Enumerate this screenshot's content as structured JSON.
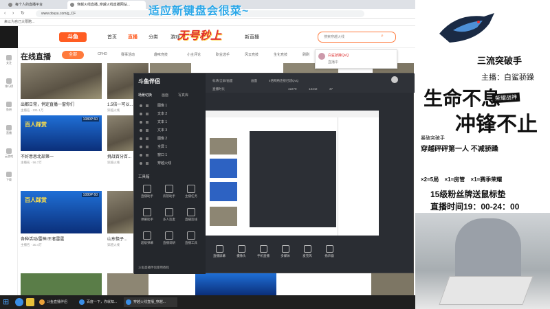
{
  "browser": {
    "tabs": [
      {
        "label": "每个人的直播平台"
      },
      {
        "label": "穿越火线直播_穿越火线直播网站..."
      }
    ],
    "url": "www.douyu.com/g_CF",
    "bookmark": "来以为自己大限赔..."
  },
  "douyu": {
    "logo": "斗鱼",
    "nav": [
      "首页",
      "直播",
      "分类",
      "游戏",
      "无号秒上",
      "新直播"
    ],
    "active_nav": "直播",
    "search_placeholder": "搜索穿越火线",
    "sidebar": [
      "关注",
      "排行榜",
      "鱼吧",
      "直播",
      "云游戏",
      "下载"
    ],
    "section_title": "在线直播",
    "all_button": "全部",
    "categories": [
      "CFHD",
      "赛事活动",
      "趣味竞技",
      "小主评论",
      "职业选手",
      "风云竞技",
      "生化竞技",
      "刷刷"
    ],
    "popup": {
      "line1": "白鲨骄躁QvQ",
      "line2": "直播中"
    },
    "cards": [
      {
        "title": "出都日常，悄定直播一窗你们",
        "meta": "主播名 · 221.1万"
      },
      {
        "title": "1.5倍一可以...",
        "meta": "穿越火线"
      },
      {
        "title": "不好意思北部第一",
        "meta": "主播名 · 56.7万"
      },
      {
        "title": "挑战百分百...",
        "meta": "穿越火线"
      },
      {
        "title": "各种活动/雷神/王者雷霆",
        "meta": "主播名 · 30.4万"
      },
      {
        "title": "山东筷子...",
        "meta": "穿越火线"
      }
    ],
    "card_promo": "百人踩赏",
    "card_res": "1080P 60"
  },
  "overlay": {
    "title": "适应新键盘会很菜~",
    "subtitle": "无号秒上"
  },
  "tool": {
    "name": "斗鱼伴侣",
    "tabs": [
      "场景切换",
      "画面",
      "写真库"
    ],
    "layers": [
      "图像 1",
      "文本 2",
      "文本 1",
      "文本 3",
      "图像 2",
      "全屏 1",
      "窗口 1",
      "穿越火线"
    ],
    "toolbox_title": "工具箱",
    "tools": [
      "直播助手",
      "房管助手",
      "主播任务",
      "弹幕助手",
      "多人连麦",
      "直播连线",
      "超级弹幕",
      "直播调研",
      "直播工具"
    ],
    "topbar": [
      "标清/全屏/画面",
      "画面",
      "4倍网络连接已建QvQ",
      "直播时长",
      "42279",
      "13442",
      "37"
    ],
    "bottom": [
      "直播屏幕",
      "摄像头",
      "手机直播",
      "多媒体",
      "麦克风",
      "扬声器"
    ],
    "footer": "斗鱼直播伴侣使用教程"
  },
  "right_panel": {
    "team_name": "三流突破手",
    "host": "主播：白鲨骄躁",
    "slogan_a": "生命不息",
    "slogan_b": "冲锋不止",
    "badge": "荣耀战神",
    "stamp": "暴破突破手",
    "sub": "穿越砰砰第一人 不减骄躁",
    "rewards": [
      "×2=5局",
      "×1=房管",
      "×1=赛季荣耀"
    ],
    "fans": "15级粉丝牌送鼠标垫",
    "time": "直播时间19：00-24：00"
  },
  "taskbar": [
    {
      "label": "斗鱼直播伴侣"
    },
    {
      "label": "百度一下，你就知..."
    },
    {
      "label": "穿越火线直播_穿越..."
    }
  ],
  "colors": {
    "accent": "#ff5d23",
    "overlay_title": "#2aa7e8",
    "overlay_sub": "#e03030"
  }
}
